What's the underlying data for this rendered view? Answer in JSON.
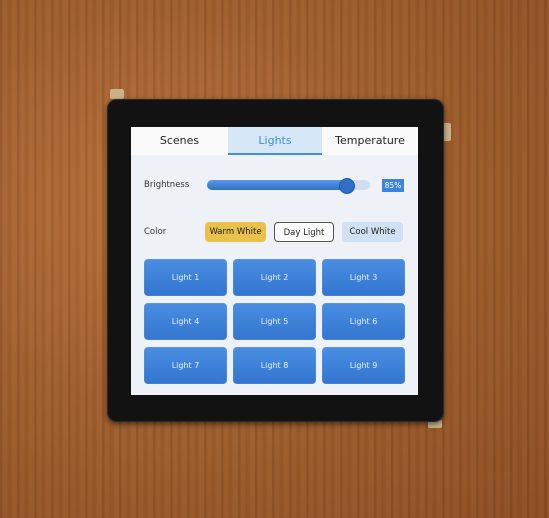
{
  "tabs": [
    {
      "label": "Scenes"
    },
    {
      "label": "Lights"
    },
    {
      "label": "Temperature"
    }
  ],
  "active_tab": "Lights",
  "brightness": {
    "label": "Brightness",
    "value_percent": 85,
    "display": "85%"
  },
  "color": {
    "label": "Color",
    "options": [
      {
        "label": "Warm White",
        "bg": "#e8c24a"
      },
      {
        "label": "Day Light",
        "bg": "#ffffff"
      },
      {
        "label": "Cool White",
        "bg": "#cfe1f3"
      }
    ]
  },
  "lights": [
    {
      "label": "Light 1"
    },
    {
      "label": "Light 2"
    },
    {
      "label": "Light 3"
    },
    {
      "label": "Light 4"
    },
    {
      "label": "Light 5"
    },
    {
      "label": "Light 6"
    },
    {
      "label": "Light 7"
    },
    {
      "label": "Light 8"
    },
    {
      "label": "Light 9"
    }
  ],
  "colors": {
    "accent": "#3f8fdc",
    "tile": "#3a7fd8",
    "warm": "#e8c24a"
  }
}
